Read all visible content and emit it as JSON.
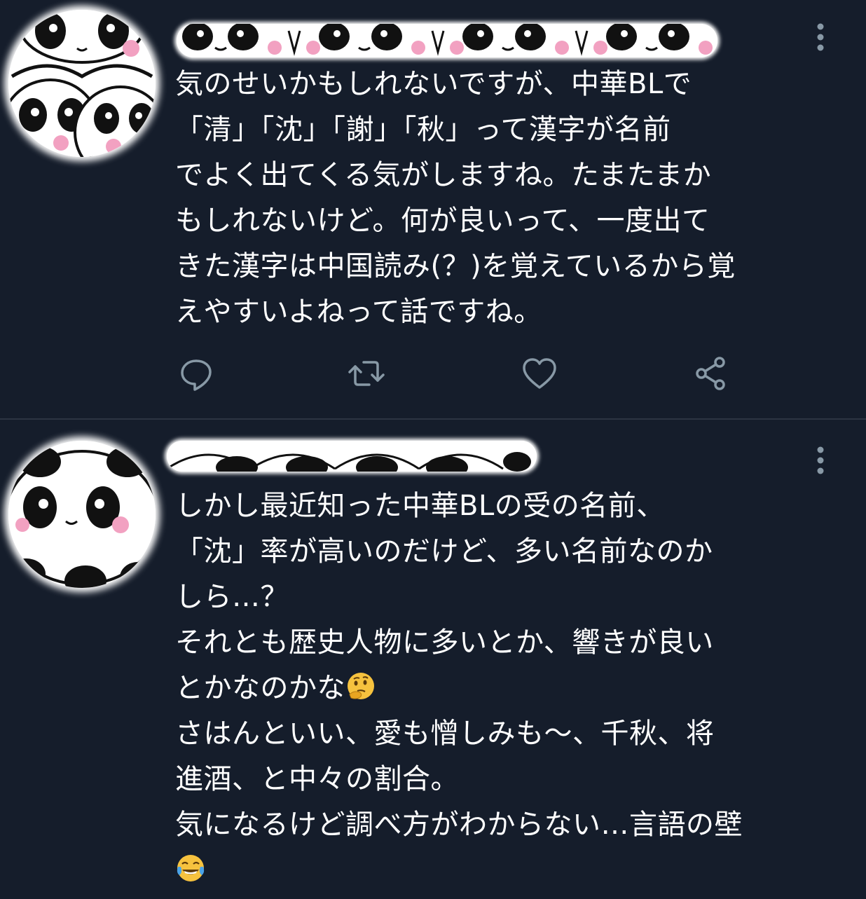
{
  "colors": {
    "background": "#151d2b",
    "text": "#ffffff",
    "icon": "#8899a6",
    "divider": "#2c3442"
  },
  "tweets": [
    {
      "avatar_icon": "panda-avatar-icon",
      "name_censored_icon": "panda-sticker-censor",
      "text_lines": [
        "気のせいかもしれないですが、中華BLで",
        "「清」「沈」「謝」「秋」って漢字が名前",
        "でよく出てくる気がしますね。たまたまか",
        "もしれないけど。何が良いって、一度出て",
        "きた漢字は中国読み(？)を覚えているから覚",
        "えやすいよねって話ですね。"
      ],
      "actions": [
        {
          "icon": "reply-icon"
        },
        {
          "icon": "retweet-icon"
        },
        {
          "icon": "heart-icon"
        },
        {
          "icon": "share-icon"
        }
      ],
      "more_icon": "more-vertical-icon"
    },
    {
      "avatar_icon": "panda-avatar-icon",
      "name_censored_icon": "panda-sticker-censor",
      "text_lines": [
        "しかし最近知った中華BLの受の名前、",
        "「沈」率が高いのだけど、多い名前なのか",
        "しら…？",
        "それとも歴史人物に多いとか、響きが良い",
        "とかなのかな",
        "さはんといい、愛も憎しみも〜、千秋、将",
        "進酒、と中々の割合。",
        "気になるけど調べ方がわからない…言語の壁",
        ""
      ],
      "emojis": [
        "thinking-face-emoji",
        "face-with-tears-of-joy-emoji"
      ],
      "more_icon": "more-vertical-icon"
    }
  ]
}
